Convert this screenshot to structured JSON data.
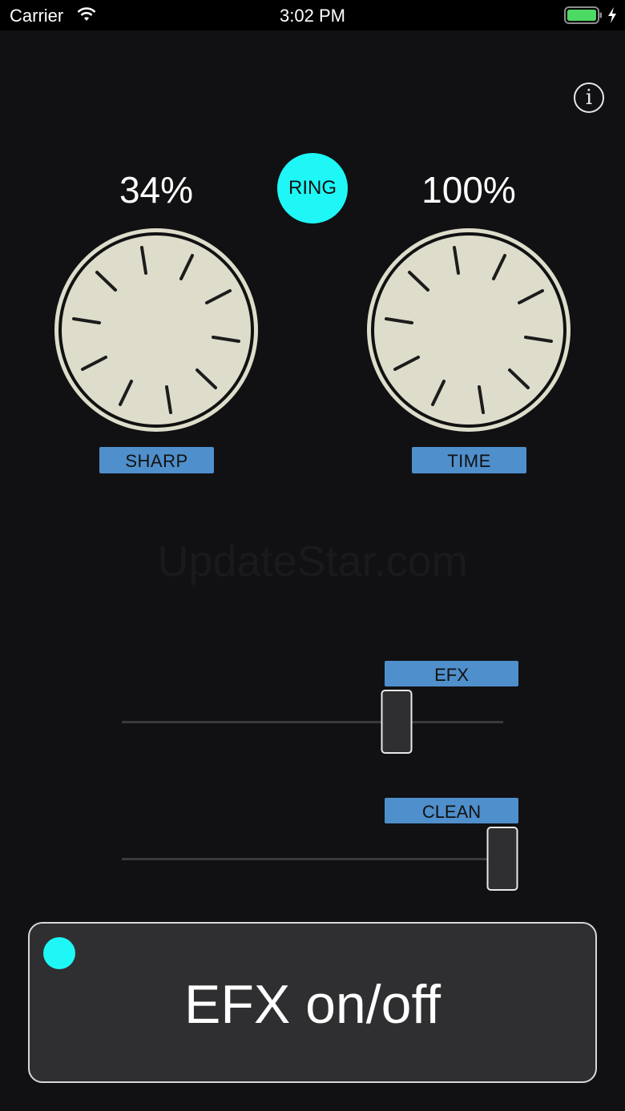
{
  "status_bar": {
    "carrier": "Carrier",
    "time": "3:02 PM",
    "battery_color": "#4cd964"
  },
  "info_icon": "i",
  "ring_button": {
    "label": "RING",
    "color": "#1ff7f7"
  },
  "knobs": {
    "sharp": {
      "value_text": "34%",
      "label": "SHARP"
    },
    "time": {
      "value_text": "100%",
      "label": "TIME"
    }
  },
  "watermark": "UpdateStar.com",
  "sliders": {
    "efx": {
      "label": "EFX",
      "value": 0.71
    },
    "clean": {
      "label": "CLEAN",
      "value": 1.0
    }
  },
  "efx_toggle": {
    "label": "EFX on/off",
    "led_color": "#1ff7f7"
  },
  "colors": {
    "accent": "#1ff7f7",
    "label_bg": "#4f8fcb",
    "knob_face": "#deddcb"
  }
}
